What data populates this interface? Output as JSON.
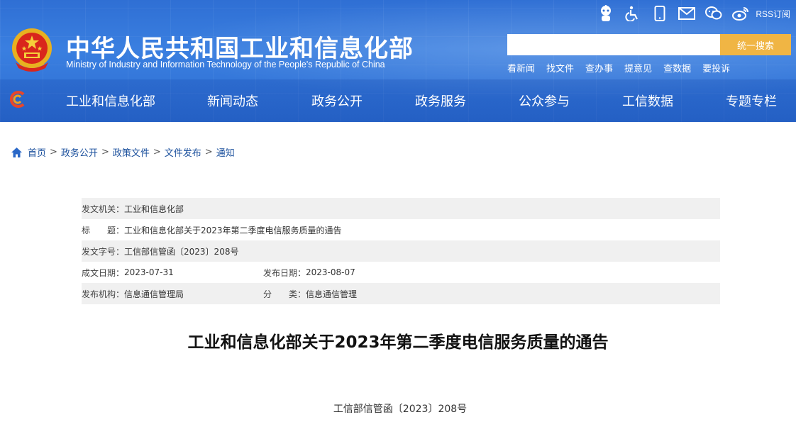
{
  "header": {
    "title": "中华人民共和国工业和信息化部",
    "subtitle": "Ministry of Industry and Information Technology of the People's Republic of China",
    "rss_label": "RSS订阅",
    "search": {
      "placeholder": "",
      "button_label": "统一搜索"
    },
    "quick_links": [
      "看新闻",
      "找文件",
      "查办事",
      "提意见",
      "查数据",
      "要投诉"
    ]
  },
  "nav": {
    "items": [
      "工业和信息化部",
      "新闻动态",
      "政务公开",
      "政务服务",
      "公众参与",
      "工信数据",
      "专题专栏"
    ]
  },
  "breadcrumb": [
    "首页",
    "政务公开",
    "政策文件",
    "文件发布",
    "通知"
  ],
  "meta": {
    "issuer_label": "发文机关：",
    "issuer": "工业和信息化部",
    "title_label": "标　　题：",
    "title": "工业和信息化部关于2023年第二季度电信服务质量的通告",
    "doc_no_label": "发文字号：",
    "doc_no": "工信部信管函〔2023〕208号",
    "created_label": "成文日期：",
    "created": "2023-07-31",
    "published_label": "发布日期：",
    "published": "2023-08-07",
    "org_label": "发布机构：",
    "org": "信息通信管理局",
    "category_label": "分　　类：",
    "category": "信息通信管理"
  },
  "document": {
    "title": "工业和信息化部关于2023年第二季度电信服务质量的通告",
    "number": "工信部信管函〔2023〕208号"
  }
}
